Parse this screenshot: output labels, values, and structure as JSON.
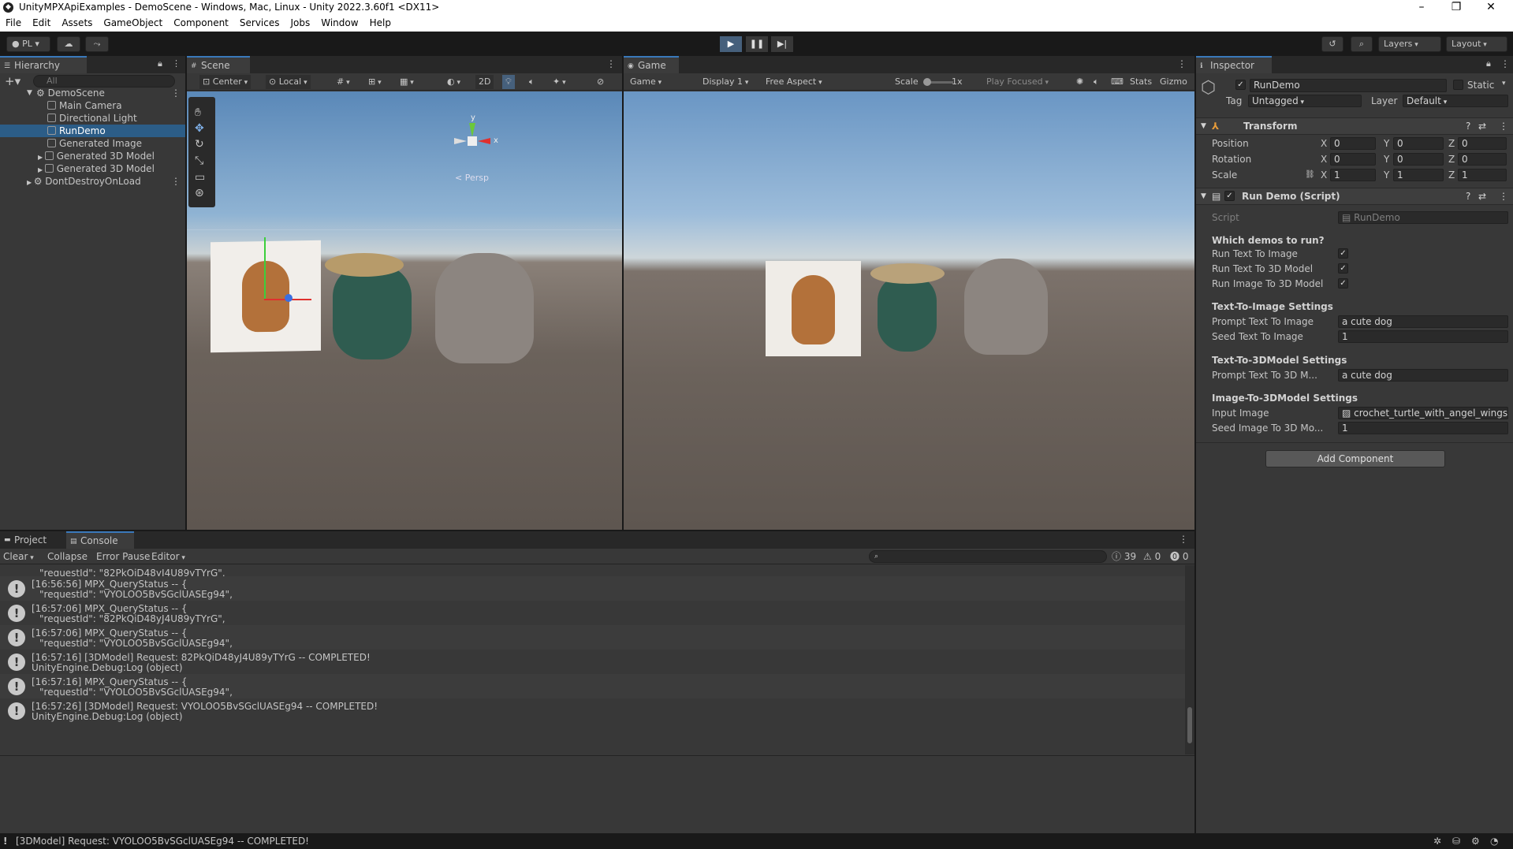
{
  "window": {
    "title": "UnityMPXApiExamples - DemoScene - Windows, Mac, Linux - Unity 2022.3.60f1 <DX11>"
  },
  "menu": [
    "File",
    "Edit",
    "Assets",
    "GameObject",
    "Component",
    "Services",
    "Jobs",
    "Window",
    "Help"
  ],
  "toolbar": {
    "account": "PL",
    "layers": "Layers",
    "layout": "Layout"
  },
  "hierarchy": {
    "tab": "Hierarchy",
    "search_placeholder": "All",
    "items": [
      {
        "label": "DemoScene",
        "depth": 0
      },
      {
        "label": "Main Camera",
        "depth": 1
      },
      {
        "label": "Directional Light",
        "depth": 1
      },
      {
        "label": "RunDemo",
        "depth": 1,
        "selected": true
      },
      {
        "label": "Generated Image",
        "depth": 1
      },
      {
        "label": "Generated 3D Model",
        "depth": 1
      },
      {
        "label": "Generated 3D Model",
        "depth": 1
      },
      {
        "label": "DontDestroyOnLoad",
        "depth": 0
      }
    ]
  },
  "scene": {
    "tab": "Scene",
    "pivot": "Center",
    "space": "Local",
    "mode2d": "2D",
    "persp": "Persp",
    "gizmo_axes": {
      "x": "x",
      "y": "y"
    }
  },
  "game": {
    "tab": "Game",
    "view": "Game",
    "display": "Display 1",
    "aspect": "Free Aspect",
    "scale_label": "Scale",
    "scale_value": "1x",
    "play_mode": "Play Focused",
    "stats": "Stats",
    "gizmos": "Gizmo"
  },
  "inspector": {
    "tab": "Inspector",
    "object_name": "RunDemo",
    "static_label": "Static",
    "tag_label": "Tag",
    "tag_value": "Untagged",
    "layer_label": "Layer",
    "layer_value": "Default",
    "transform": {
      "title": "Transform",
      "rows": [
        {
          "label": "Position",
          "x": "0",
          "y": "0",
          "z": "0"
        },
        {
          "label": "Rotation",
          "x": "0",
          "y": "0",
          "z": "0"
        },
        {
          "label": "Scale",
          "x": "1",
          "y": "1",
          "z": "1"
        }
      ]
    },
    "script": {
      "title": "Run Demo (Script)",
      "script_label": "Script",
      "script_value": "RunDemo",
      "header_which": "Which demos to run?",
      "run_text_to_image": "Run Text To Image",
      "run_text_to_3d": "Run Text To 3D Model",
      "run_image_to_3d": "Run Image To 3D Model",
      "header_t2i": "Text-To-Image Settings",
      "prompt_t2i_label": "Prompt Text To Image",
      "prompt_t2i_value": "a cute dog",
      "seed_t2i_label": "Seed Text To Image",
      "seed_t2i_value": "1",
      "header_t23d": "Text-To-3DModel Settings",
      "prompt_t23d_label": "Prompt Text To 3D M...",
      "prompt_t23d_value": "a cute dog",
      "header_i23d": "Image-To-3DModel Settings",
      "input_image_label": "Input Image",
      "input_image_value": "crochet_turtle_with_angel_wings",
      "seed_i23d_label": "Seed Image To 3D Mo...",
      "seed_i23d_value": "1"
    },
    "add_component": "Add Component"
  },
  "console": {
    "tab_project": "Project",
    "tab_console": "Console",
    "clear": "Clear",
    "collapse": "Collapse",
    "error_pause": "Error Pause",
    "editor": "Editor",
    "count_info": "39",
    "count_warn": "0",
    "count_error": "0",
    "partial_top": "\"requestId\": \"82PkQiD48yJ4U89yTYrG\",",
    "entries": [
      {
        "l1": "[16:56:56] MPX_QueryStatus -- {",
        "l2": "\"requestId\": \"VYOLOO5BvSGclUASEg94\","
      },
      {
        "l1": "[16:57:06] MPX_QueryStatus -- {",
        "l2": "\"requestId\": \"82PkQiD48yJ4U89yTYrG\","
      },
      {
        "l1": "[16:57:06] MPX_QueryStatus -- {",
        "l2": "\"requestId\": \"VYOLOO5BvSGclUASEg94\","
      },
      {
        "l1": "[16:57:16] [3DModel] Request: 82PkQiD48yJ4U89yTYrG -- COMPLETED!",
        "l2": "UnityEngine.Debug:Log (object)"
      },
      {
        "l1": "[16:57:16] MPX_QueryStatus -- {",
        "l2": "\"requestId\": \"VYOLOO5BvSGclUASEg94\","
      },
      {
        "l1": "[16:57:26] [3DModel] Request: VYOLOO5BvSGclUASEg94 -- COMPLETED!",
        "l2": "UnityEngine.Debug:Log (object)"
      }
    ]
  },
  "status": {
    "message": "[3DModel] Request: VYOLOO5BvSGclUASEg94 -- COMPLETED!"
  },
  "colors": {
    "selection": "#2c5d87",
    "play_active": "#46607c",
    "panel": "#383838",
    "accent_tab": "#3a79bb"
  }
}
